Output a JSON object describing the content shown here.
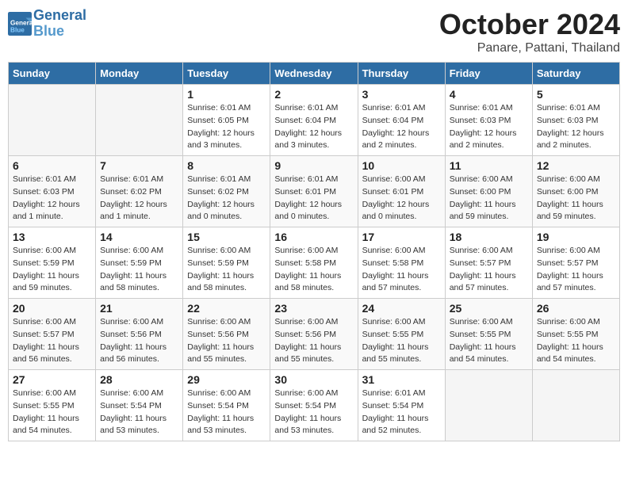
{
  "header": {
    "logo_line1": "General",
    "logo_line2": "Blue",
    "title": "October 2024",
    "subtitle": "Panare, Pattani, Thailand"
  },
  "days_of_week": [
    "Sunday",
    "Monday",
    "Tuesday",
    "Wednesday",
    "Thursday",
    "Friday",
    "Saturday"
  ],
  "weeks": [
    [
      {
        "day": "",
        "info": ""
      },
      {
        "day": "",
        "info": ""
      },
      {
        "day": "1",
        "info": "Sunrise: 6:01 AM\nSunset: 6:05 PM\nDaylight: 12 hours\nand 3 minutes."
      },
      {
        "day": "2",
        "info": "Sunrise: 6:01 AM\nSunset: 6:04 PM\nDaylight: 12 hours\nand 3 minutes."
      },
      {
        "day": "3",
        "info": "Sunrise: 6:01 AM\nSunset: 6:04 PM\nDaylight: 12 hours\nand 2 minutes."
      },
      {
        "day": "4",
        "info": "Sunrise: 6:01 AM\nSunset: 6:03 PM\nDaylight: 12 hours\nand 2 minutes."
      },
      {
        "day": "5",
        "info": "Sunrise: 6:01 AM\nSunset: 6:03 PM\nDaylight: 12 hours\nand 2 minutes."
      }
    ],
    [
      {
        "day": "6",
        "info": "Sunrise: 6:01 AM\nSunset: 6:03 PM\nDaylight: 12 hours\nand 1 minute."
      },
      {
        "day": "7",
        "info": "Sunrise: 6:01 AM\nSunset: 6:02 PM\nDaylight: 12 hours\nand 1 minute."
      },
      {
        "day": "8",
        "info": "Sunrise: 6:01 AM\nSunset: 6:02 PM\nDaylight: 12 hours\nand 0 minutes."
      },
      {
        "day": "9",
        "info": "Sunrise: 6:01 AM\nSunset: 6:01 PM\nDaylight: 12 hours\nand 0 minutes."
      },
      {
        "day": "10",
        "info": "Sunrise: 6:00 AM\nSunset: 6:01 PM\nDaylight: 12 hours\nand 0 minutes."
      },
      {
        "day": "11",
        "info": "Sunrise: 6:00 AM\nSunset: 6:00 PM\nDaylight: 11 hours\nand 59 minutes."
      },
      {
        "day": "12",
        "info": "Sunrise: 6:00 AM\nSunset: 6:00 PM\nDaylight: 11 hours\nand 59 minutes."
      }
    ],
    [
      {
        "day": "13",
        "info": "Sunrise: 6:00 AM\nSunset: 5:59 PM\nDaylight: 11 hours\nand 59 minutes."
      },
      {
        "day": "14",
        "info": "Sunrise: 6:00 AM\nSunset: 5:59 PM\nDaylight: 11 hours\nand 58 minutes."
      },
      {
        "day": "15",
        "info": "Sunrise: 6:00 AM\nSunset: 5:59 PM\nDaylight: 11 hours\nand 58 minutes."
      },
      {
        "day": "16",
        "info": "Sunrise: 6:00 AM\nSunset: 5:58 PM\nDaylight: 11 hours\nand 58 minutes."
      },
      {
        "day": "17",
        "info": "Sunrise: 6:00 AM\nSunset: 5:58 PM\nDaylight: 11 hours\nand 57 minutes."
      },
      {
        "day": "18",
        "info": "Sunrise: 6:00 AM\nSunset: 5:57 PM\nDaylight: 11 hours\nand 57 minutes."
      },
      {
        "day": "19",
        "info": "Sunrise: 6:00 AM\nSunset: 5:57 PM\nDaylight: 11 hours\nand 57 minutes."
      }
    ],
    [
      {
        "day": "20",
        "info": "Sunrise: 6:00 AM\nSunset: 5:57 PM\nDaylight: 11 hours\nand 56 minutes."
      },
      {
        "day": "21",
        "info": "Sunrise: 6:00 AM\nSunset: 5:56 PM\nDaylight: 11 hours\nand 56 minutes."
      },
      {
        "day": "22",
        "info": "Sunrise: 6:00 AM\nSunset: 5:56 PM\nDaylight: 11 hours\nand 55 minutes."
      },
      {
        "day": "23",
        "info": "Sunrise: 6:00 AM\nSunset: 5:56 PM\nDaylight: 11 hours\nand 55 minutes."
      },
      {
        "day": "24",
        "info": "Sunrise: 6:00 AM\nSunset: 5:55 PM\nDaylight: 11 hours\nand 55 minutes."
      },
      {
        "day": "25",
        "info": "Sunrise: 6:00 AM\nSunset: 5:55 PM\nDaylight: 11 hours\nand 54 minutes."
      },
      {
        "day": "26",
        "info": "Sunrise: 6:00 AM\nSunset: 5:55 PM\nDaylight: 11 hours\nand 54 minutes."
      }
    ],
    [
      {
        "day": "27",
        "info": "Sunrise: 6:00 AM\nSunset: 5:55 PM\nDaylight: 11 hours\nand 54 minutes."
      },
      {
        "day": "28",
        "info": "Sunrise: 6:00 AM\nSunset: 5:54 PM\nDaylight: 11 hours\nand 53 minutes."
      },
      {
        "day": "29",
        "info": "Sunrise: 6:00 AM\nSunset: 5:54 PM\nDaylight: 11 hours\nand 53 minutes."
      },
      {
        "day": "30",
        "info": "Sunrise: 6:00 AM\nSunset: 5:54 PM\nDaylight: 11 hours\nand 53 minutes."
      },
      {
        "day": "31",
        "info": "Sunrise: 6:01 AM\nSunset: 5:54 PM\nDaylight: 11 hours\nand 52 minutes."
      },
      {
        "day": "",
        "info": ""
      },
      {
        "day": "",
        "info": ""
      }
    ]
  ]
}
